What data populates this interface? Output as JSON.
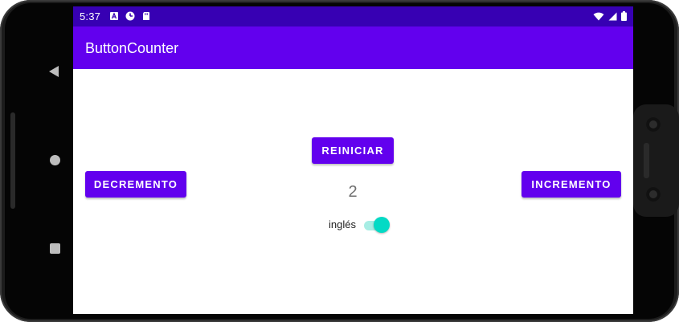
{
  "status_bar": {
    "time": "5:37",
    "left_icons": [
      "a-badge-icon",
      "pie-clock-icon",
      "sd-card-icon"
    ],
    "right_icons": [
      "wifi-icon",
      "signal-icon",
      "battery-icon"
    ],
    "color": "#3700b3"
  },
  "app_bar": {
    "title": "ButtonCounter",
    "color": "#6200ee"
  },
  "main": {
    "reset_label": "REINICIAR",
    "decrement_label": "DECREMENTO",
    "increment_label": "INCREMENTO",
    "counter_value": "2",
    "switch": {
      "label": "inglés",
      "checked": true,
      "accent": "#03dac5"
    }
  },
  "navigation": {
    "buttons": [
      "back-icon",
      "home-icon",
      "recents-icon"
    ]
  }
}
